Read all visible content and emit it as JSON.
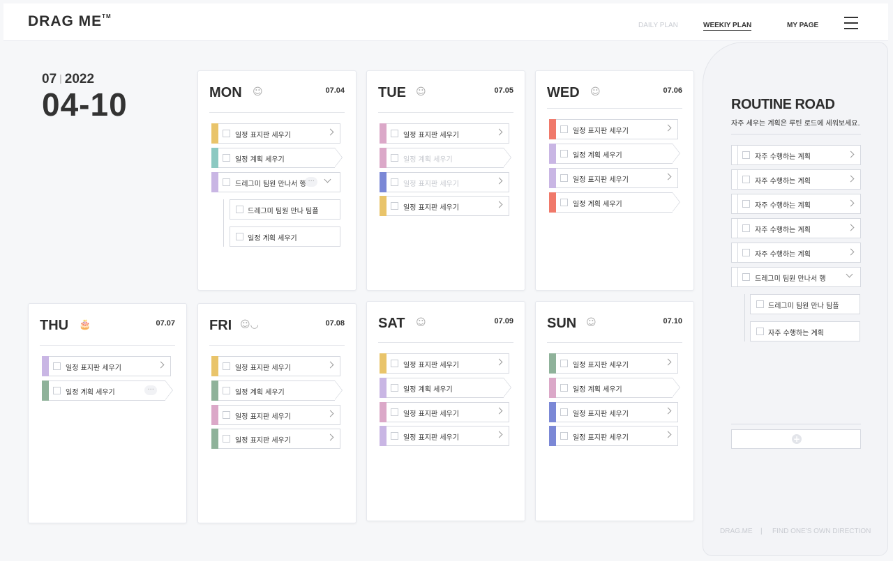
{
  "header": {
    "logo": "DRAG ME",
    "logo_tm": "TM",
    "nav": [
      "DAILY PLAN",
      "WEEKIY PLAN",
      "MY PAGE"
    ]
  },
  "date": {
    "month": "07",
    "year": "2022",
    "range": "04-10"
  },
  "colors": {
    "yellow": "#e9c46a",
    "teal": "#8cc9c2",
    "lavender": "#c9b6e4",
    "pink": "#dba8c8",
    "blue": "#7b88d6",
    "coral": "#f0796a",
    "sage": "#8fb29a"
  },
  "days": {
    "mon": {
      "name": "MON",
      "emoji": "☺",
      "date": "07.04",
      "tasks": [
        "일정 표지판 세우기",
        "일정 계획 세우기",
        "드레그미 팀원 만나서 행",
        "드레그미 팀원 만나 팀플",
        "일정 계획 세우기"
      ]
    },
    "tue": {
      "name": "TUE",
      "emoji": "☺",
      "date": "07.05",
      "tasks": [
        "일정 표지판 세우기",
        "일정 계획 세우기",
        "일정 표지판 세우기",
        "일정 표지판 세우기"
      ]
    },
    "wed": {
      "name": "WED",
      "emoji": "☺",
      "date": "07.06",
      "tasks": [
        "일정 표지판 세우기",
        "일정 계획 세우기",
        "일정 표지판 세우기",
        "일정 계획 세우기"
      ]
    },
    "thu": {
      "name": "THU",
      "emoji": "🎂",
      "date": "07.07",
      "tasks": [
        "일정 표지판 세우기",
        "일정 계획 세우기"
      ]
    },
    "fri": {
      "name": "FRI",
      "emoji": "☺◡",
      "date": "07.08",
      "tasks": [
        "일정 표지판 세우기",
        "일정 계획 세우기",
        "일정 표지판 세우기",
        "일정 표지판 세우기"
      ]
    },
    "sat": {
      "name": "SAT",
      "emoji": "☺",
      "date": "07.09",
      "tasks": [
        "일정 표지판 세우기",
        "일정 계획 세우기",
        "일정 표지판 세우기",
        "일정 표지판 세우기"
      ]
    },
    "sun": {
      "name": "SUN",
      "emoji": "☺",
      "date": "07.10",
      "tasks": [
        "일정 표지판 세우기",
        "일정 계획 세우기",
        "일정 표지판 세우기",
        "일정 표지판 세우기"
      ]
    }
  },
  "routine": {
    "title": "ROUTINE ROAD",
    "subtitle": "자주 세우는 계획은 루틴 로드에 세워보세요.",
    "items": [
      "자주 수행하는 계획",
      "자주 수행하는 계획",
      "자주 수행하는 계획",
      "자주 수행하는 계획",
      "자주 수행하는 계획",
      "드레그미 팀원 만나서 행",
      "드레그미 팀원 만나 팀플",
      "자주 수행하는 계획"
    ]
  },
  "footer": {
    "brand": "DRAG.ME",
    "sep": "|",
    "slogan": "FIND ONE'S OWN DIRECTION"
  }
}
